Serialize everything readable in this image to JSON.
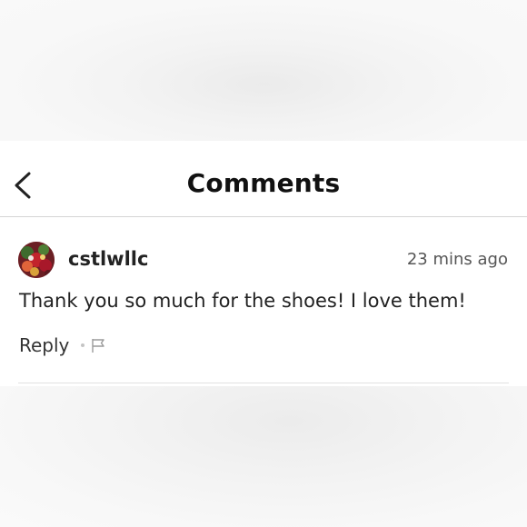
{
  "header": {
    "title": "Comments",
    "back_icon": "chevron-left-icon"
  },
  "comment": {
    "username": "cstlwllc",
    "timestamp": "23 mins ago",
    "text": "Thank you so much for the shoes! I love them!",
    "reply_label": "Reply",
    "flag_icon": "flag-icon",
    "avatar_icon": "avatar-flowers-image"
  },
  "colors": {
    "text_primary": "#222222",
    "text_secondary": "#555555",
    "divider": "#d4d4d4",
    "background": "#ffffff"
  }
}
